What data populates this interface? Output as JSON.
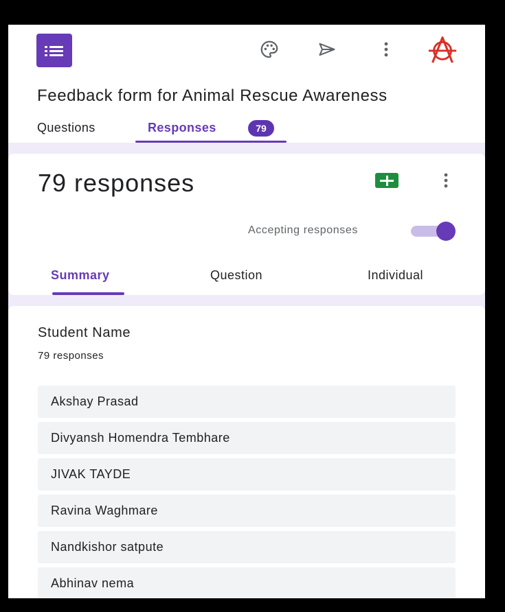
{
  "form": {
    "title": "Feedback form for Animal Rescue Awareness",
    "tabs": {
      "questions": "Questions",
      "responses": "Responses"
    },
    "response_badge": "79"
  },
  "toolbar": {
    "icons": [
      "palette-icon",
      "send-icon",
      "more-vert-icon",
      "account-avatar"
    ]
  },
  "summary": {
    "count_text": "79 responses",
    "accepting_label": "Accepting responses",
    "accepting": true,
    "tabs": {
      "summary": "Summary",
      "question": "Question",
      "individual": "Individual"
    }
  },
  "question": {
    "title": "Student Name",
    "count_text": "79 responses",
    "answers": [
      "Akshay Prasad",
      "Divyansh Homendra Tembhare",
      "JIVAK TAYDE",
      "Ravina Waghmare",
      "Nandkishor satpute",
      "Abhinav nema"
    ]
  },
  "colors": {
    "accent": "#673ab7",
    "background": "#f0ebf8",
    "sheets_green": "#1e8e3e",
    "avatar_red": "#d93025"
  }
}
